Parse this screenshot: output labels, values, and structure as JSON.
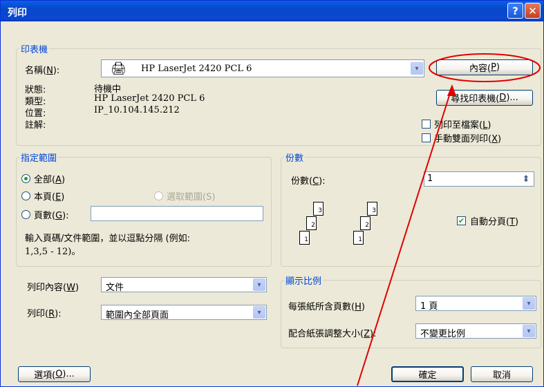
{
  "window": {
    "title": "列印",
    "help": "?",
    "close": "✕"
  },
  "printer": {
    "legend": "印表機",
    "name_label": "名稱(",
    "name_key": "N",
    "name_label_end": "):",
    "selected": "HP LaserJet 2420 PCL 6",
    "properties_label": "內容(",
    "properties_key": "P",
    "properties_end": ")",
    "find_label": "尋找印表機(",
    "find_key": "D",
    "find_end": ")...",
    "status_label": "狀態:",
    "status_value": "待機中",
    "type_label": "類型:",
    "type_value": "HP LaserJet 2420 PCL 6",
    "where_label": "位置:",
    "where_value": "IP_10.104.145.212",
    "comment_label": "註解:",
    "print_to_file": "列印至檔案(",
    "print_to_file_key": "L",
    "print_to_file_end": ")",
    "print_to_file_checked": false,
    "manual_duplex": "手動雙面列印(",
    "manual_duplex_key": "X",
    "manual_duplex_end": ")",
    "manual_duplex_checked": false
  },
  "range": {
    "legend": "指定範圍",
    "all": "全部(",
    "all_key": "A",
    "all_end": ")",
    "current": "本頁(",
    "current_key": "E",
    "current_end": ")",
    "selection": "選取範圍(S)",
    "pages": "頁數(",
    "pages_key": "G",
    "pages_end": "):",
    "pages_value": "",
    "hint_line1": "輸入頁碼/文件範圍，並以逗點分隔 (例如:",
    "hint_line2": "1,3,5 - 12)。",
    "selected": "all"
  },
  "copies": {
    "legend": "份數",
    "label": "份數(",
    "key": "C",
    "label_end": "):",
    "value": "1",
    "collate": "自動分頁(",
    "collate_key": "T",
    "collate_end": ")",
    "collate_checked": true,
    "stack_numbers": [
      "1",
      "2",
      "3"
    ]
  },
  "print_what": {
    "label": "列印內容(",
    "key": "W",
    "label_end": ")",
    "value": "文件"
  },
  "print_pages": {
    "label": "列印(",
    "key": "R",
    "label_end": "):",
    "value": "範圍內全部頁面"
  },
  "zoom": {
    "legend": "顯示比例",
    "pps_label": "每張紙所含頁數(",
    "pps_key": "H",
    "pps_end": ")",
    "pps_value": "1 頁",
    "scale_label": "配合紙張調整大小(",
    "scale_key": "Z",
    "scale_end": "):",
    "scale_value": "不變更比例"
  },
  "footer": {
    "options": "選項(",
    "options_key": "O",
    "options_end": ")...",
    "ok": "確定",
    "cancel": "取消"
  },
  "icons": {
    "dropdown": "▾",
    "spin": "⬍",
    "check": "✔"
  },
  "annotation_color": "#e00000"
}
